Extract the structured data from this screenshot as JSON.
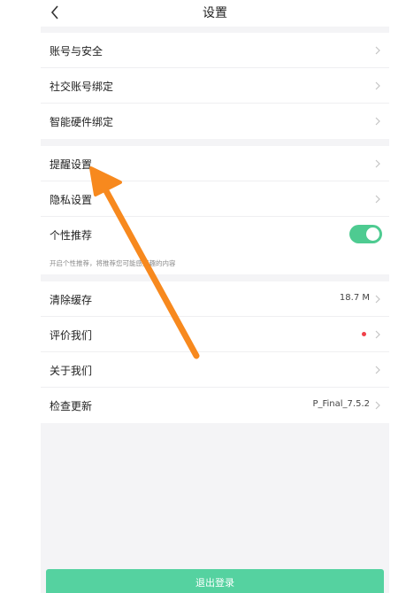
{
  "header": {
    "title": "设置"
  },
  "groups": [
    {
      "items": [
        {
          "label": "账号与安全"
        },
        {
          "label": "社交账号绑定"
        },
        {
          "label": "智能硬件绑定"
        }
      ]
    },
    {
      "items": [
        {
          "label": "提醒设置"
        },
        {
          "label": "隐私设置"
        },
        {
          "label": "个性推荐",
          "toggle_on": true
        }
      ],
      "hint": "开启个性推荐，将推荐您可能感兴趣的内容"
    },
    {
      "items": [
        {
          "label": "清除缓存",
          "value": "18.7 M"
        },
        {
          "label": "评价我们",
          "has_red_dot": true
        },
        {
          "label": "关于我们"
        },
        {
          "label": "检查更新",
          "value": "P_Final_7.5.2"
        }
      ]
    }
  ],
  "logout_button": {
    "label": "退出登录"
  },
  "colors": {
    "accent_green": "#4ecb91",
    "logout_green": "#55d2a0",
    "annotation_arrow": "#f7891e",
    "badge_red": "#f0414a"
  },
  "icons": {
    "back": "chevron-left-icon",
    "row_arrow": "chevron-right-icon",
    "annotation": "annotation-arrow-icon"
  }
}
